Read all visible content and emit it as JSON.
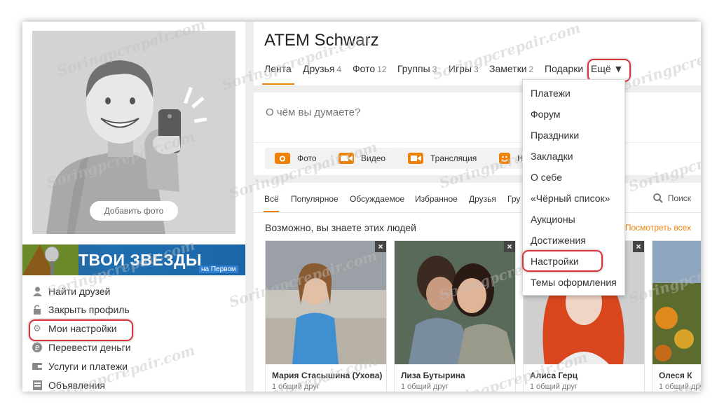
{
  "profile": {
    "name": "ATEM Schwarz",
    "add_photo": "Добавить фото"
  },
  "banner": {
    "title": "ТВОИ ЗВЕЗДЫ",
    "subtitle": "на Первом"
  },
  "left_menu": [
    {
      "label": "Найти друзей",
      "icon": "person-icon"
    },
    {
      "label": "Закрыть профиль",
      "icon": "lock-icon"
    },
    {
      "label": "Мои настройки",
      "icon": "gear-icon"
    },
    {
      "label": "Перевести деньги",
      "icon": "ruble-icon"
    },
    {
      "label": "Услуги и платежи",
      "icon": "wallet-icon"
    },
    {
      "label": "Объявления",
      "icon": "ads-icon"
    }
  ],
  "tabs": [
    {
      "label": "Лента",
      "count": ""
    },
    {
      "label": "Друзья",
      "count": "4"
    },
    {
      "label": "Фото",
      "count": "12"
    },
    {
      "label": "Группы",
      "count": "3"
    },
    {
      "label": "Игры",
      "count": "3"
    },
    {
      "label": "Заметки",
      "count": "2"
    },
    {
      "label": "Подарки",
      "count": ""
    },
    {
      "label": "Ещё ▼",
      "count": ""
    }
  ],
  "composer": {
    "placeholder": "О чём вы думаете?",
    "buttons": [
      {
        "label": "Фото",
        "icon": "camera-icon"
      },
      {
        "label": "Видео",
        "icon": "video-icon"
      },
      {
        "label": "Трансляция",
        "icon": "broadcast-icon"
      },
      {
        "label": "Н",
        "icon": "smile-icon"
      }
    ]
  },
  "feed": {
    "tabs": [
      "Всё",
      "Популярное",
      "Обсуждаемое",
      "Избранное",
      "Друзья",
      "Гру"
    ],
    "search_label": "Поиск",
    "section_title": "Возможно, вы знаете этих людей",
    "see_all": "Посмотреть всех",
    "people": [
      {
        "name": "Мария Стасышина (Ухова)",
        "friends": "1 общий друг"
      },
      {
        "name": "Лиза Бутырина",
        "friends": "1 общий друг"
      },
      {
        "name": "Алиса Герц",
        "friends": "1 общий друг"
      },
      {
        "name": "Олеся К",
        "friends": "1 общий друг"
      }
    ]
  },
  "dropdown": [
    "Платежи",
    "Форум",
    "Праздники",
    "Закладки",
    "О себе",
    "«Чёрный список»",
    "Аукционы",
    "Достижения",
    "Настройки",
    "Темы оформления"
  ],
  "watermark": "Soringpcrepair.com",
  "colors": {
    "accent": "#ee8208",
    "highlight": "#d9343a"
  }
}
